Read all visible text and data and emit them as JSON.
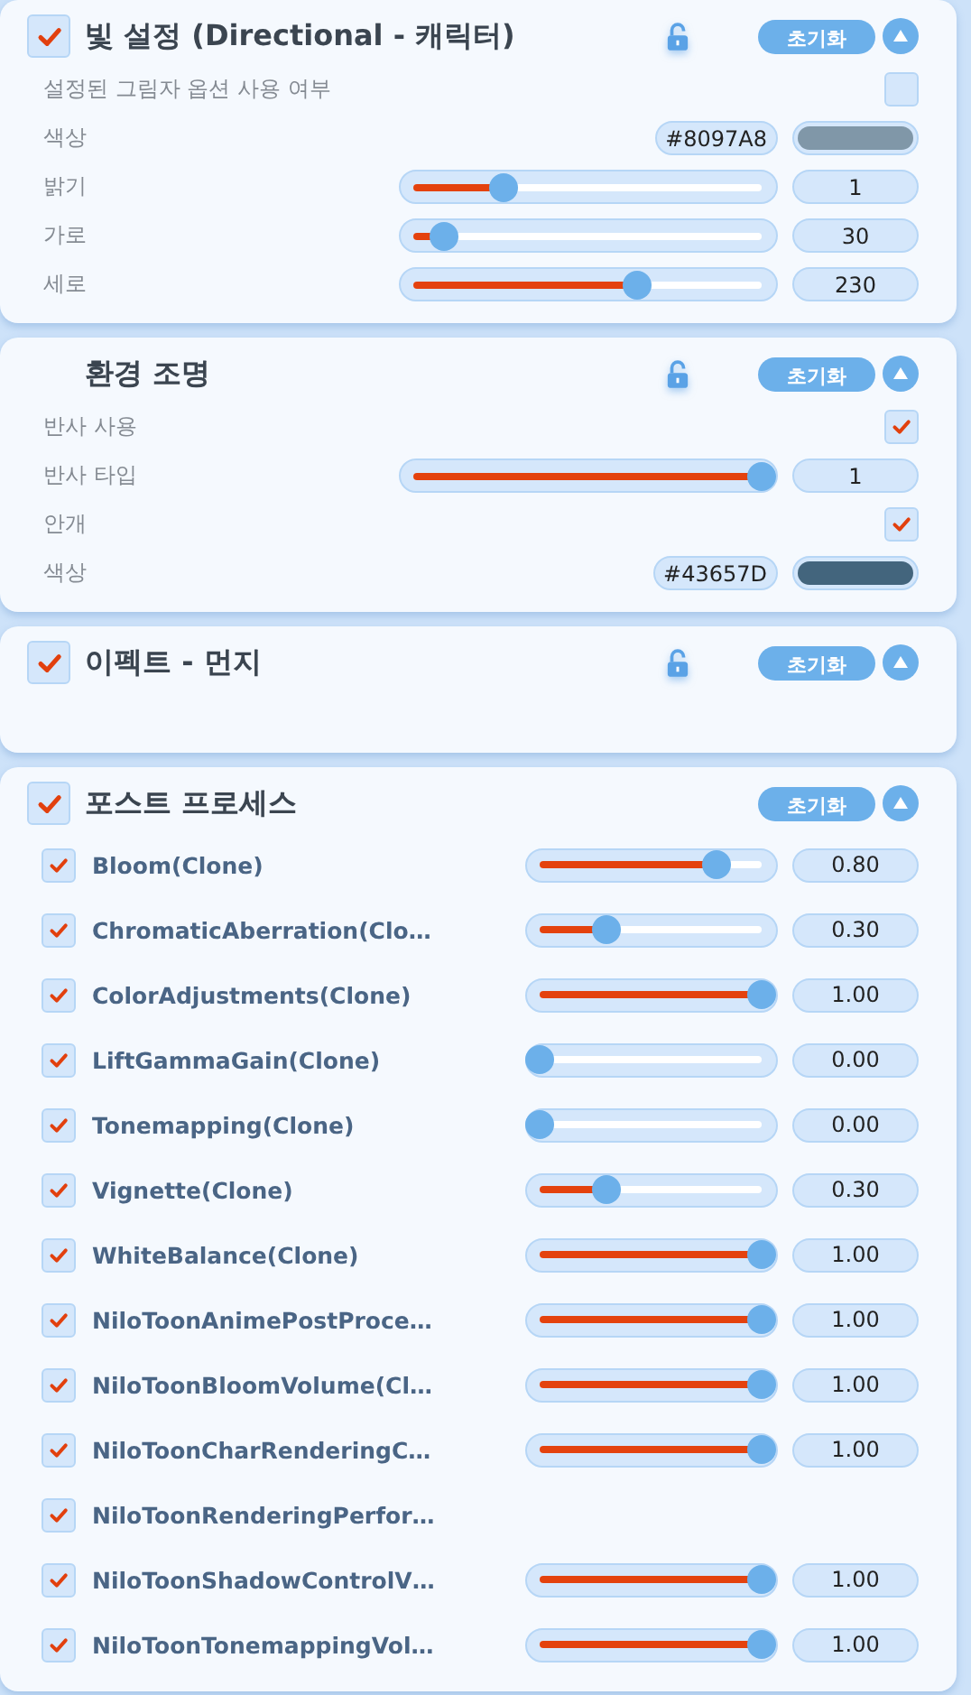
{
  "panels": [
    {
      "title": "빛 설정 (Directional - 캐릭터)",
      "checked": true,
      "locked": false,
      "reset": "초기화",
      "expanded": true,
      "rows": [
        {
          "kind": "checkbox",
          "label": "설정된 그림자 옵션 사용 여부",
          "checked": false
        },
        {
          "kind": "color",
          "label": "색상",
          "value": "#8097A8",
          "color": "#8097a8"
        },
        {
          "kind": "slider",
          "label": "밝기",
          "level": 0.26,
          "value": "1"
        },
        {
          "kind": "slider",
          "label": "가로",
          "level": 0.09,
          "value": "30"
        },
        {
          "kind": "slider",
          "label": "세로",
          "level": 0.64,
          "value": "230"
        }
      ]
    },
    {
      "title": "환경 조명",
      "locked": false,
      "reset": "초기화",
      "expanded": true,
      "rows": [
        {
          "kind": "checkbox",
          "label": "반사 사용",
          "checked": true
        },
        {
          "kind": "slider",
          "label": "반사 타입",
          "level": 1,
          "value": "1"
        },
        {
          "kind": "checkbox",
          "label": "안개",
          "checked": true
        },
        {
          "kind": "color",
          "label": "색상",
          "value": "#43657D",
          "color": "#43657d"
        }
      ]
    },
    {
      "title": "이펙트 - 먼지",
      "checked": true,
      "locked": false,
      "reset": "초기화",
      "expanded": true
    },
    {
      "title": "포스트 프로세스",
      "checked": true,
      "reset": "초기화",
      "expanded": true,
      "effects": [
        {
          "name": "Bloom(Clone)",
          "checked": true,
          "level": 0.8,
          "value": "0.80"
        },
        {
          "name": "ChromaticAberration(Clo…",
          "checked": true,
          "level": 0.3,
          "value": "0.30"
        },
        {
          "name": "ColorAdjustments(Clone)",
          "checked": true,
          "level": 1,
          "value": "1.00"
        },
        {
          "name": "LiftGammaGain(Clone)",
          "checked": true,
          "level": 0,
          "value": "0.00"
        },
        {
          "name": "Tonemapping(Clone)",
          "checked": true,
          "level": 0,
          "value": "0.00"
        },
        {
          "name": "Vignette(Clone)",
          "checked": true,
          "level": 0.3,
          "value": "0.30"
        },
        {
          "name": "WhiteBalance(Clone)",
          "checked": true,
          "level": 1,
          "value": "1.00"
        },
        {
          "name": "NiloToonAnimePostProce…",
          "checked": true,
          "level": 1,
          "value": "1.00"
        },
        {
          "name": "NiloToonBloomVolume(Cl…",
          "checked": true,
          "level": 1,
          "value": "1.00"
        },
        {
          "name": "NiloToonCharRenderingC…",
          "checked": true,
          "level": 1,
          "value": "1.00"
        },
        {
          "name": "NiloToonRenderingPerfor…",
          "checked": true
        },
        {
          "name": "NiloToonShadowControlV…",
          "checked": true,
          "level": 1,
          "value": "1.00"
        },
        {
          "name": "NiloToonTonemappingVol…",
          "checked": true,
          "level": 1,
          "value": "1.00"
        }
      ]
    }
  ]
}
